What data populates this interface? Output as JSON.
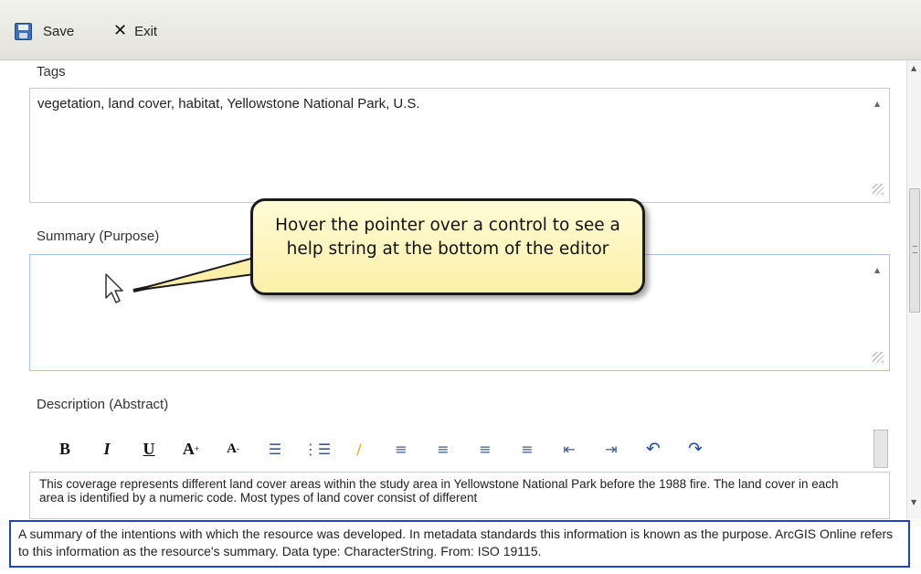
{
  "toolbar": {
    "save_label": "Save",
    "exit_label": "Exit"
  },
  "fields": {
    "tags": {
      "label": "Tags",
      "value": "vegetation, land cover, habitat, Yellowstone National Park, U.S."
    },
    "summary": {
      "label": "Summary (Purpose)",
      "value": ""
    },
    "description": {
      "label": "Description (Abstract)",
      "value": "This coverage represents different land cover areas within the study area in Yellowstone National Park before the 1988 fire. The land cover in each area is identified by a numeric code. Most types of land cover consist of different"
    }
  },
  "rich_text_toolbar": {
    "bold": "B",
    "italic": "I",
    "underline": "U",
    "font_larger": "A",
    "font_smaller": "A",
    "bullets": "☰",
    "numbering": "⋮☰",
    "highlight": "∕",
    "align_left": "≡",
    "align_center": "≡",
    "align_right": "≡",
    "justify": "≡",
    "outdent": "⇤",
    "indent": "⇥",
    "undo": "↶",
    "redo": "↷"
  },
  "callout": {
    "text": "Hover the pointer over a control to see a help string at the bottom of the editor"
  },
  "help_bar": {
    "text": "A summary of the intentions with which the resource was developed. In metadata standards this information is known as the purpose. ArcGIS Online refers to this information as the resource's summary. Data type: CharacterString. From: ISO 19115."
  },
  "colors": {
    "help_border": "#1e44c8",
    "callout_fill": "#fcf0a8",
    "summary_border": "#a9c6e6"
  }
}
